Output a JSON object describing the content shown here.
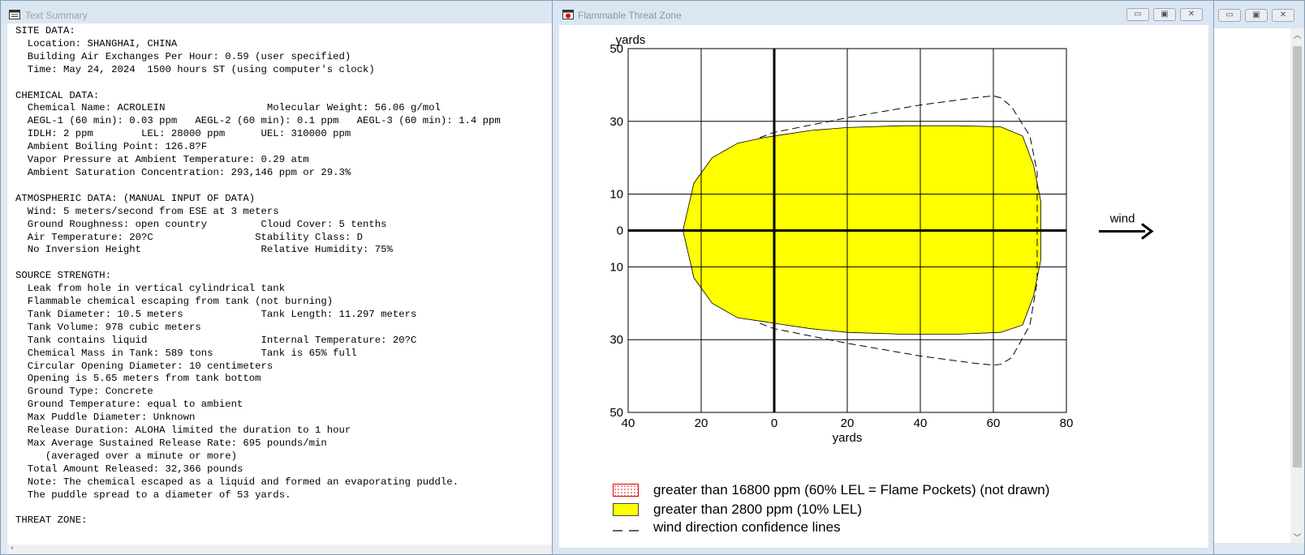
{
  "text_window": {
    "title": "Text Summary",
    "lines": [
      "SITE DATA:",
      "  Location: SHANGHAI, CHINA",
      "  Building Air Exchanges Per Hour: 0.59 (user specified)",
      "  Time: May 24, 2024  1500 hours ST (using computer's clock)",
      "",
      "CHEMICAL DATA:",
      "  Chemical Name: ACROLEIN                 Molecular Weight: 56.06 g/mol",
      "  AEGL-1 (60 min): 0.03 ppm   AEGL-2 (60 min): 0.1 ppm   AEGL-3 (60 min): 1.4 ppm",
      "  IDLH: 2 ppm        LEL: 28000 ppm      UEL: 310000 ppm",
      "  Ambient Boiling Point: 126.8?F",
      "  Vapor Pressure at Ambient Temperature: 0.29 atm",
      "  Ambient Saturation Concentration: 293,146 ppm or 29.3%",
      "",
      "ATMOSPHERIC DATA: (MANUAL INPUT OF DATA)",
      "  Wind: 5 meters/second from ESE at 3 meters",
      "  Ground Roughness: open country         Cloud Cover: 5 tenths",
      "  Air Temperature: 20?C                 Stability Class: D",
      "  No Inversion Height                    Relative Humidity: 75%",
      "",
      "SOURCE STRENGTH:",
      "  Leak from hole in vertical cylindrical tank",
      "  Flammable chemical escaping from tank (not burning)",
      "  Tank Diameter: 10.5 meters             Tank Length: 11.297 meters",
      "  Tank Volume: 978 cubic meters",
      "  Tank contains liquid                   Internal Temperature: 20?C",
      "  Chemical Mass in Tank: 589 tons        Tank is 65% full",
      "  Circular Opening Diameter: 10 centimeters",
      "  Opening is 5.65 meters from tank bottom",
      "  Ground Type: Concrete",
      "  Ground Temperature: equal to ambient",
      "  Max Puddle Diameter: Unknown",
      "  Release Duration: ALOHA limited the duration to 1 hour",
      "  Max Average Sustained Release Rate: 695 pounds/min",
      "     (averaged over a minute or more)",
      "  Total Amount Released: 32,366 pounds",
      "  Note: The chemical escaped as a liquid and formed an evaporating puddle.",
      "  The puddle spread to a diameter of 53 yards.",
      "",
      "THREAT ZONE:"
    ]
  },
  "threat_window": {
    "title": "Flammable Threat Zone",
    "wind_label": "wind",
    "legend": [
      {
        "label": "greater than 16800 ppm (60% LEL = Flame Pockets) (not drawn)",
        "color": "#ff0000"
      },
      {
        "label": "greater than 2800 ppm (10% LEL)",
        "color": "#ffff00"
      },
      {
        "label": "wind direction confidence lines",
        "color": "#000000"
      }
    ]
  },
  "chart_data": {
    "type": "area",
    "title": "",
    "xlabel": "yards",
    "ylabel": "yards",
    "xlim": [
      -40,
      80
    ],
    "ylim": [
      -50,
      50
    ],
    "x_tick_labels": [
      "40",
      "20",
      "0",
      "20",
      "40",
      "60",
      "80"
    ],
    "y_tick_labels": [
      "50",
      "30",
      "10",
      "0",
      "10",
      "30",
      "50"
    ],
    "grid": true,
    "series": [
      {
        "name": "greater than 2800 ppm (10% LEL)",
        "color": "#ffff00",
        "x": [
          -25,
          -22,
          -17,
          -10,
          -3,
          0,
          10,
          20,
          35,
          50,
          62,
          68,
          71,
          73,
          73,
          71,
          68,
          62,
          50,
          35,
          20,
          10,
          0,
          -3,
          -10,
          -17,
          -22,
          -25
        ],
        "y": [
          0,
          13,
          20,
          24,
          25.5,
          26,
          27.5,
          28.3,
          28.8,
          28.8,
          28.5,
          26,
          18,
          8,
          -8,
          -18,
          -26,
          -28,
          -28.5,
          -28.5,
          -28,
          -27,
          -25.5,
          -25,
          -24,
          -20,
          -13,
          0
        ]
      },
      {
        "name": "wind direction confidence lines",
        "color": "#000000",
        "x": [
          -4,
          0,
          20,
          40,
          55,
          60,
          62,
          65,
          70,
          72,
          72,
          70,
          65,
          62,
          60,
          55,
          40,
          20,
          0,
          -4
        ],
        "y": [
          25.5,
          27,
          31,
          34.5,
          36.5,
          37,
          36.5,
          34,
          26,
          16,
          -14,
          -26,
          -35,
          -36.8,
          -37,
          -36.5,
          -34.5,
          -31,
          -27,
          -25.5
        ]
      }
    ]
  }
}
